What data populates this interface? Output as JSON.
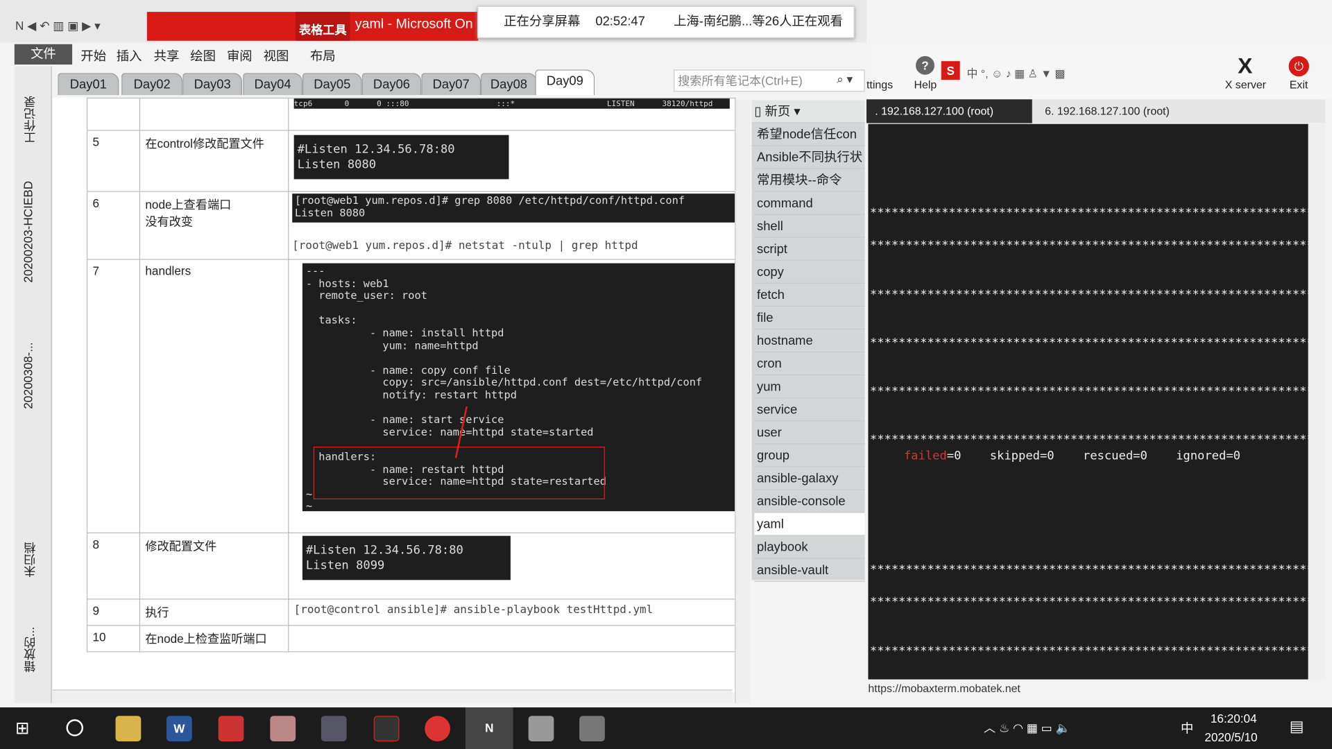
{
  "window": {
    "title": "yaml - Microsoft On",
    "context_tab": "表格工具"
  },
  "share_banner": {
    "status": "正在分享屏幕",
    "time": "02:52:47",
    "viewers": "上海-南纪鹏...等26人正在观看"
  },
  "ribbon": {
    "tabs": [
      "文件",
      "开始",
      "插入",
      "共享",
      "绘图",
      "审阅",
      "视图",
      "布局"
    ]
  },
  "notebook_tabs": [
    "Day01",
    "Day02",
    "Day03",
    "Day04",
    "Day05",
    "Day06",
    "Day07",
    "Day08",
    "Day09"
  ],
  "active_tab": "Day09",
  "search": {
    "placeholder": "搜索所有笔记本(Ctrl+E)"
  },
  "left_pane": {
    "items": [
      "工作记录",
      "20200203-HCIEBD",
      "20200308-...",
      "未归档",
      "错放的..."
    ]
  },
  "table": {
    "top_terminal": "tcp6       0      0 :::80                   :::*                    LISTEN      38120/httpd",
    "rows": [
      {
        "num": "5",
        "desc": "在control修改配置文件",
        "lines": [
          "#Listen 12.34.56.78:80",
          "Listen 8080"
        ]
      },
      {
        "num": "6",
        "desc1": "node上查看端口",
        "desc2": "没有改变",
        "term1": "[root@web1 yum.repos.d]# grep 8080 /etc/httpd/conf/httpd.conf",
        "term2": "Listen 8080",
        "cmd": "[root@web1 yum.repos.d]# netstat -ntulp | grep httpd"
      },
      {
        "num": "7",
        "desc": "handlers",
        "yaml": [
          "---",
          "- hosts: web1",
          "  remote_user: root",
          "",
          "  tasks:",
          "          - name: install httpd",
          "            yum: name=httpd",
          "",
          "          - name: copy conf file",
          "            copy: src=/ansible/httpd.conf dest=/etc/httpd/conf",
          "            notify: restart httpd",
          "",
          "          - name: start service",
          "            service: name=httpd state=started",
          "",
          "  handlers:",
          "          - name: restart httpd",
          "            service: name=httpd state=restarted",
          "~",
          "~"
        ]
      },
      {
        "num": "8",
        "desc": "修改配置文件",
        "lines": [
          "#Listen 12.34.56.78:80",
          "Listen 8099"
        ]
      },
      {
        "num": "9",
        "desc": "执行",
        "cmd": "[root@control ansible]# ansible-playbook  testHttpd.yml"
      },
      {
        "num": "10",
        "desc": "在node上检查监听端口"
      }
    ]
  },
  "pages": {
    "header": "新页",
    "items": [
      "希望node信任con",
      "Ansible不同执行状",
      "常用模块--命令",
      "command",
      "shell",
      "script",
      "copy",
      "fetch",
      "file",
      "hostname",
      "cron",
      "yum",
      "service",
      "user",
      "group",
      "ansible-galaxy",
      "ansible-console",
      "yaml",
      "playbook",
      "ansible-vault"
    ],
    "selected": "yaml"
  },
  "mobaxterm": {
    "toolbar": {
      "settings": "ttings",
      "help": "Help",
      "xserver": "X server",
      "exit": "Exit"
    },
    "tabs": [
      ". 192.168.127.100 (root)",
      "6. 192.168.127.100 (root)"
    ],
    "stars": "****************************************************************************",
    "recap": {
      "failed": "failed",
      "failed_val": "=0",
      "skipped": "skipped=0",
      "rescued": "rescued=0",
      "ignored": "ignored=0"
    },
    "status_url": "https://mobaxterm.mobatek.net"
  },
  "taskbar": {
    "time": "16:20:04",
    "date": "2020/5/10",
    "ime": "中"
  },
  "colors": {
    "accent_red": "#d81a16",
    "terminal_bg": "#1e1e1e"
  }
}
